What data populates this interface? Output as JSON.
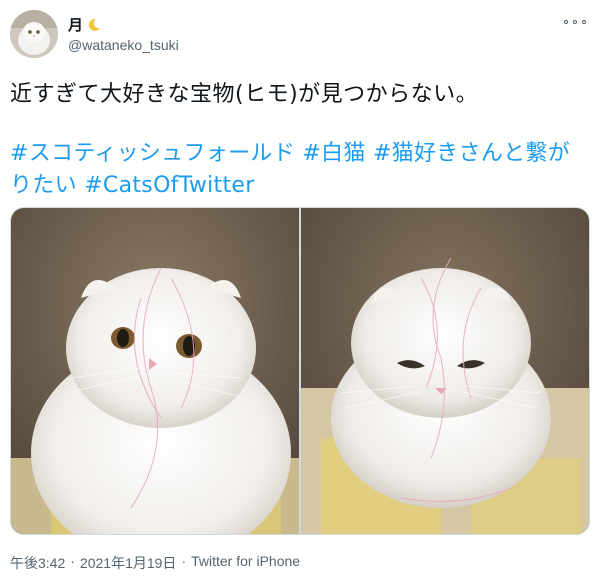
{
  "author": {
    "name": "月",
    "handle": "@wataneko_tsuki"
  },
  "tweet": {
    "text": "近すぎて大好きな宝物(ヒモ)が見つからない。",
    "hashtags_line1": [
      "#スコティッシュフォールド",
      "#白猫",
      "#猫好きさんと繋が"
    ],
    "hashtags_line2": [
      "りたい",
      "#CatsOfTwitter"
    ]
  },
  "media": {
    "photos": [
      {
        "alt_subject": "white-cat-looking-up"
      },
      {
        "alt_subject": "white-cat-looking-down"
      }
    ]
  },
  "meta": {
    "time": "午後3:42",
    "separator1": "·",
    "date": "2021年1月19日",
    "separator2": "·",
    "source": "Twitter for iPhone"
  },
  "colors": {
    "link": "#1d9bf0",
    "secondary_text": "#536471",
    "moon": "#f5c542"
  }
}
